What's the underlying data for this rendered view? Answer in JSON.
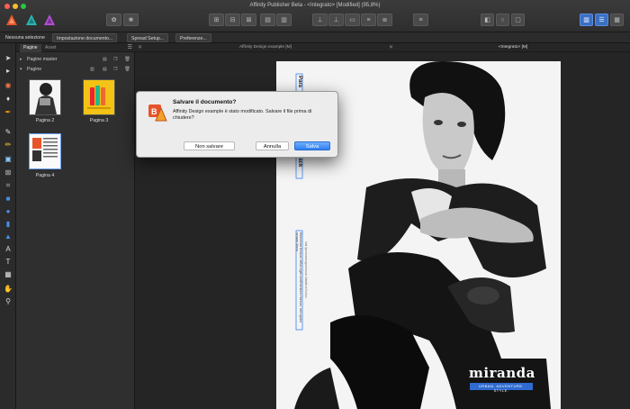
{
  "window": {
    "title": "Affinity Publisher Beta - <Integrato> [Modified] (95,8%)"
  },
  "context_bar": {
    "items": [
      "Nessuna selezione",
      "Impostazione documento...",
      "Spread Setup...",
      "Preferenze..."
    ]
  },
  "panel": {
    "tabs": [
      "Pagine",
      "Asset"
    ],
    "rows": {
      "master": "Pagine master",
      "pages": "Pagine"
    },
    "pages": [
      {
        "label": "Pagina 2"
      },
      {
        "label": "Pagina 3"
      },
      {
        "label": "Pagina 4"
      }
    ]
  },
  "document_tabs": [
    "Affinity Design example [M]",
    "<Integrato> [M]"
  ],
  "page": {
    "brand": "miranda",
    "tagline": "URBAN. ADVENTURE. STYLE.",
    "frame_text_1": "Para",
    "frame_text_2": "black",
    "frame_text_3": "Maecenas tempus, tellus eget condimentum rhoncus, sem quam semper libero",
    "frame_text_4": "sed ipsum nam quam nunc blandit vel luctus"
  },
  "dialog": {
    "title": "Salvare il documento?",
    "message": "Affinity Design example è stato modificato. Salvare il file prima di chiudere?",
    "buttons": {
      "dont_save": "Non salvare",
      "cancel": "Annulla",
      "save": "Salva"
    }
  },
  "colors": {
    "accent": "#2f7ff0",
    "publisher_orange": "#e8542a",
    "designer_teal": "#2bb5b0",
    "photo_purple": "#b14fd1"
  }
}
